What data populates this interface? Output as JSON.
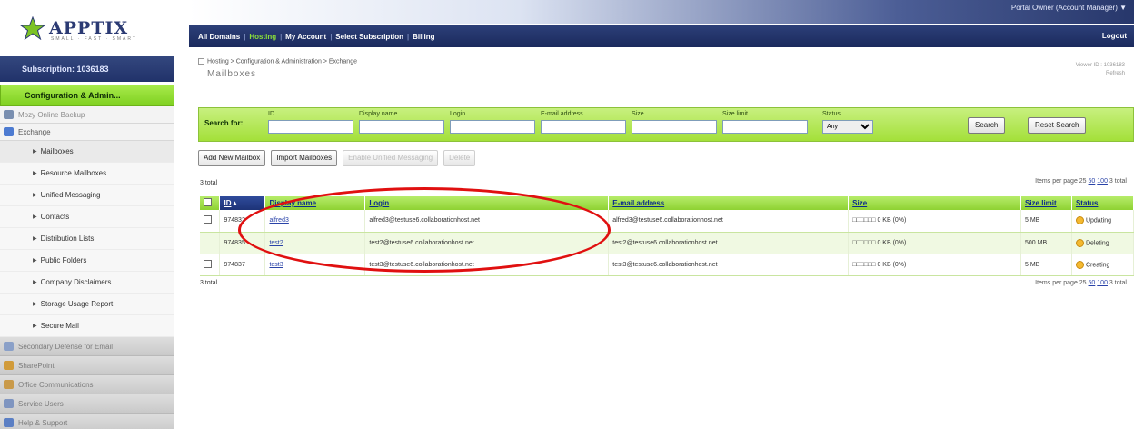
{
  "logo": {
    "word": "APPTIX",
    "tagline": "SMALL · FAST · SMART"
  },
  "header": {
    "user_info": "Portal Owner (Account Manager) ▼",
    "logout": "Logout",
    "nav": [
      "All Domains",
      "Hosting",
      "My Account",
      "Select Subscription",
      "Billing"
    ],
    "active_nav": "Hosting"
  },
  "sidebar": {
    "subscription": "Subscription: 1036183",
    "config_header": "Configuration & Admin...",
    "top_items": [
      "Mozy Online Backup",
      "Exchange"
    ],
    "exchange_items": [
      "Mailboxes",
      "Resource Mailboxes",
      "Unified Messaging",
      "Contacts",
      "Distribution Lists",
      "Public Folders",
      "Company Disclaimers",
      "Storage Usage Report",
      "Secure Mail"
    ],
    "bottom_items": [
      "Secondary Defense for Email",
      "SharePoint",
      "Office Communications",
      "Service Users",
      "Help & Support"
    ]
  },
  "breadcrumb": "Hosting > Configuration & Administration > Exchange",
  "page_title": "Mailboxes",
  "right_info": {
    "line1": "Viewer ID : 1036183",
    "line2": "Refresh"
  },
  "search": {
    "label": "Search for:",
    "fields": [
      "ID",
      "Display name",
      "Login",
      "E-mail address",
      "Size",
      "Size limit"
    ],
    "status_label": "Status",
    "status_value": "Any",
    "search_button": "Search",
    "reset_button": "Reset Search"
  },
  "toolbar": [
    "Add New Mailbox",
    "Import Mailboxes",
    "Enable Unified Messaging",
    "Delete"
  ],
  "count_top": "3 total",
  "count_bottom": "3 total",
  "paging": {
    "prefix": "Items per page 25",
    "opt1": "50",
    "opt2": "100",
    "suffix": "3 total"
  },
  "table": {
    "columns": [
      "ID",
      "Display name",
      "Login",
      "E-mail address",
      "Size",
      "Size limit",
      "Status"
    ],
    "rows": [
      {
        "id": "974832",
        "name": "alfred3",
        "login": "alfred3@testuse6.collaborationhost.net",
        "email": "alfred3@testuse6.collaborationhost.net",
        "size": "□□□□□□ 0 KB (0%)",
        "limit": "5 MB",
        "status": "Updating",
        "checkbox": true
      },
      {
        "id": "974835",
        "name": "test2",
        "login": "test2@testuse6.collaborationhost.net",
        "email": "test2@testuse6.collaborationhost.net",
        "size": "□□□□□□ 0 KB (0%)",
        "limit": "500 MB",
        "status": "Deleting",
        "checkbox": false
      },
      {
        "id": "974837",
        "name": "test3",
        "login": "test3@testuse6.collaborationhost.net",
        "email": "test3@testuse6.collaborationhost.net",
        "size": "□□□□□□ 0 KB (0%)",
        "limit": "5 MB",
        "status": "Creating",
        "checkbox": true
      }
    ]
  },
  "colors": {
    "nav_blue": "#1b2a5d",
    "accent_green": "#8ed232",
    "annotation_red": "#e01010"
  }
}
